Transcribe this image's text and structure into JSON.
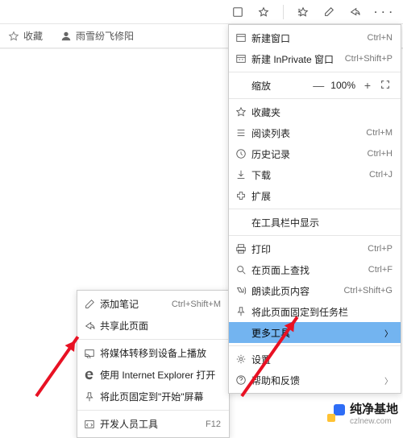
{
  "titlebar": {},
  "bookmarks": {
    "fav": "收藏",
    "item1": "雨雪纷飞修阳"
  },
  "menu": {
    "new_window": "新建窗口",
    "sc_new_window": "Ctrl+N",
    "new_inprivate": "新建 InPrivate 窗口",
    "sc_new_inprivate": "Ctrl+Shift+P",
    "zoom_label": "缩放",
    "zoom_value": "100%",
    "favorites": "收藏夹",
    "reading_list": "阅读列表",
    "sc_reading_list": "Ctrl+M",
    "history": "历史记录",
    "sc_history": "Ctrl+H",
    "downloads": "下载",
    "sc_downloads": "Ctrl+J",
    "extensions": "扩展",
    "show_in_toolbar": "在工具栏中显示",
    "print": "打印",
    "sc_print": "Ctrl+P",
    "find": "在页面上查找",
    "sc_find": "Ctrl+F",
    "read_aloud": "朗读此页内容",
    "sc_read_aloud": "Ctrl+Shift+G",
    "pin_taskbar": "将此页面固定到任务栏",
    "more_tools": "更多工具",
    "settings": "设置",
    "help": "帮助和反馈"
  },
  "submenu": {
    "add_notes": "添加笔记",
    "sc_add_notes": "Ctrl+Shift+M",
    "share": "共享此页面",
    "cast": "将媒体转移到设备上播放",
    "open_ie": "使用 Internet Explorer 打开",
    "pin_start": "将此页固定到\"开始\"屏幕",
    "devtools": "开发人员工具",
    "sc_devtools": "F12"
  },
  "brand": {
    "name": "纯净基地",
    "url": "czlnew.com"
  }
}
